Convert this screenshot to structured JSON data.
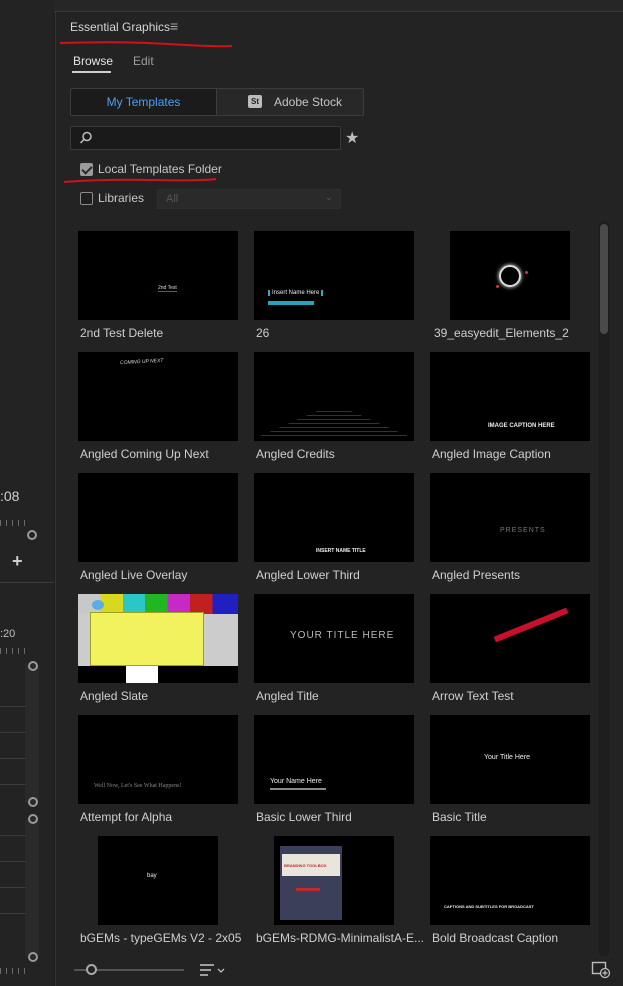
{
  "left_strip": {
    "timecode": ":08",
    "tick20": ":20",
    "add_symbol": "+"
  },
  "panel": {
    "title": "Essential Graphics",
    "menu_icon": "hamburger-menu-icon",
    "tabs": [
      {
        "label": "Browse",
        "active": true
      },
      {
        "label": "Edit",
        "active": false
      }
    ],
    "segmented": {
      "my_templates": "My Templates",
      "adobe_stock": "Adobe Stock",
      "stock_badge": "St",
      "active": "My Templates"
    },
    "search": {
      "value": "",
      "placeholder": ""
    },
    "local_templates": {
      "label": "Local Templates Folder",
      "checked": true
    },
    "libraries": {
      "label": "Libraries",
      "checked": false,
      "select_value": "All"
    },
    "accent_color": "#4c9ff4",
    "annotation_color": "#d0121b"
  },
  "templates": [
    {
      "label": "2nd Test Delete",
      "thumb_text": "2nd Test"
    },
    {
      "label": "26",
      "thumb_text": "Insert Name Here"
    },
    {
      "label": "39_easyedit_Elements_2",
      "thumb_text": ""
    },
    {
      "label": "Angled Coming Up Next",
      "thumb_text": "COMING UP NEXT"
    },
    {
      "label": "Angled Credits",
      "thumb_text": ""
    },
    {
      "label": "Angled Image Caption",
      "thumb_text": "IMAGE CAPTION HERE"
    },
    {
      "label": "Angled Live Overlay",
      "thumb_text": ""
    },
    {
      "label": "Angled Lower Third",
      "thumb_text": "INSERT NAME TITLE"
    },
    {
      "label": "Angled Presents",
      "thumb_text": "PRESENTS"
    },
    {
      "label": "Angled Slate",
      "thumb_text": ""
    },
    {
      "label": "Angled Title",
      "thumb_text": "YOUR TITLE HERE"
    },
    {
      "label": "Arrow Text Test",
      "thumb_text": ""
    },
    {
      "label": "Attempt for Alpha",
      "thumb_text": "Well Now, Let's See What Happens!"
    },
    {
      "label": "Basic Lower Third",
      "thumb_text": "Your Name Here"
    },
    {
      "label": "Basic Title",
      "thumb_text": "Your Title Here"
    },
    {
      "label": "bGEMs - typeGEMs V2 - 2x05",
      "thumb_text": "bay"
    },
    {
      "label": "bGEMs-RDMG-MinimalistA-E...",
      "thumb_text": "BRANDING TOOLBOX"
    },
    {
      "label": "Bold Broadcast Caption",
      "thumb_text": "CAPTIONS AND SUBTITLES FOR BROADCAST"
    }
  ],
  "footer": {
    "zoom_level": 0.15,
    "sort_icon": "sort-list-icon",
    "new_item_icon": "new-item-icon"
  }
}
